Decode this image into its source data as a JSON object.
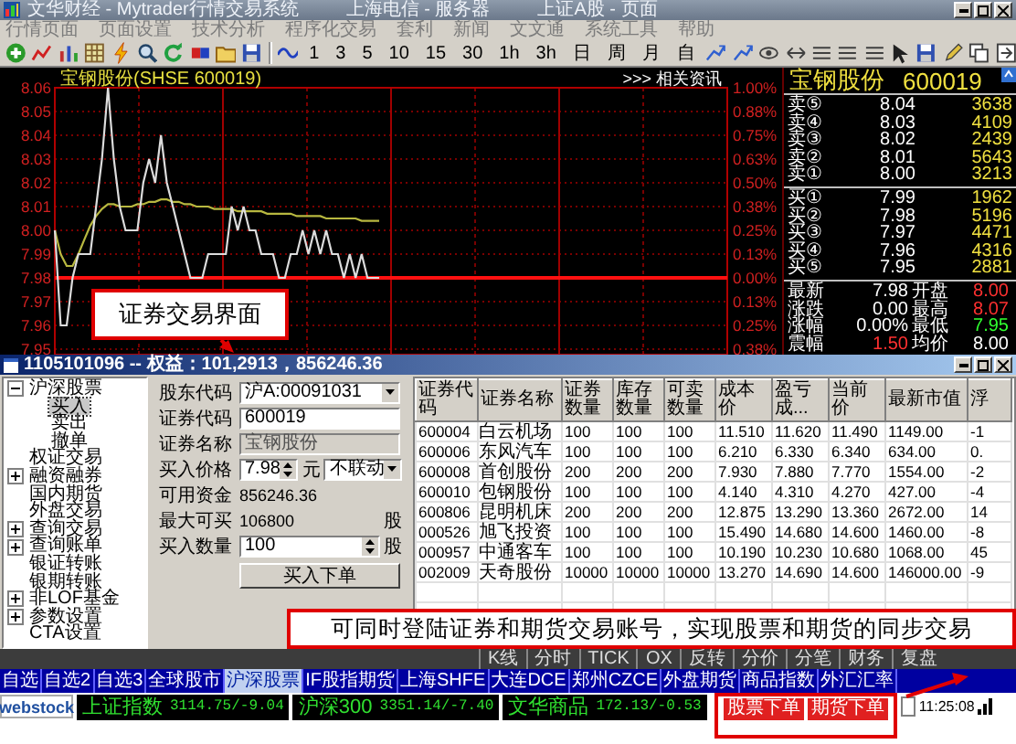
{
  "window": {
    "title": "文华财经 - Mytrader行情交易系统",
    "server": "上海电信 - 服务器",
    "page": "上证A股 - 页面"
  },
  "menu": [
    "行情页面",
    "页面设置",
    "技术分析",
    "程序化交易",
    "套利",
    "新闻",
    "文文通",
    "系统工具",
    "帮助"
  ],
  "toolbar": {
    "periods": [
      "1",
      "3",
      "5",
      "10",
      "15",
      "30",
      "1h",
      "3h",
      "日",
      "周",
      "月",
      "自"
    ]
  },
  "chart": {
    "title": "宝钢股份(SHSE 600019)",
    "link": ">>> 相关资讯",
    "chart_data": {
      "type": "line",
      "grid": true,
      "ylim": [
        7.95,
        8.06
      ],
      "yticks": [
        8.06,
        8.05,
        8.04,
        8.03,
        8.02,
        8.01,
        {
          "value": 8.0,
          "label": "8.00"
        },
        7.99,
        7.98,
        7.97,
        7.96,
        7.95
      ],
      "series": [
        {
          "color": "#dcdcdc",
          "values": [
            8.0,
            7.96,
            7.96,
            7.98,
            7.99,
            7.99,
            7.99,
            8.01,
            8.03,
            8.06,
            8.03,
            8.01,
            8.0,
            8.0,
            8.0,
            8.02,
            8.03,
            8.02,
            8.04,
            8.02,
            8.01,
            8.0,
            7.99,
            7.98,
            7.98,
            7.98,
            7.99,
            7.99,
            7.99,
            7.99,
            8.01,
            8.0,
            8.01,
            8.0,
            8.0,
            7.99,
            7.99,
            7.99,
            7.98,
            7.98,
            7.99,
            7.99,
            8.0,
            7.99,
            8.0,
            7.99,
            8.0,
            7.99,
            7.99,
            7.98,
            7.99,
            7.98,
            7.99,
            7.98,
            7.98,
            7.98,
            null,
            null,
            null,
            null,
            null,
            null,
            null,
            null,
            null,
            null,
            null,
            null,
            null,
            null,
            null,
            null,
            null,
            null,
            null,
            null,
            null,
            null,
            null,
            null,
            null,
            null,
            null,
            null,
            null,
            null,
            null,
            null,
            null,
            null,
            null,
            null,
            null,
            null,
            null,
            null,
            null,
            null,
            null,
            null,
            null,
            null,
            null,
            null,
            null,
            null,
            null,
            null,
            null,
            null,
            null,
            null,
            null,
            null,
            null
          ]
        },
        {
          "color": "#b8b840",
          "values": [
            8.0,
            7.99,
            7.985,
            7.985,
            7.99,
            7.996,
            8.002,
            8.006,
            8.009,
            8.011,
            8.011,
            8.01,
            8.01,
            8.01,
            8.011,
            8.011,
            8.012,
            8.012,
            8.013,
            8.013,
            8.012,
            8.012,
            8.011,
            8.011,
            8.01,
            8.01,
            8.01,
            8.009,
            8.009,
            8.009,
            8.009,
            8.008,
            8.008,
            8.008,
            8.008,
            8.008,
            8.007,
            8.007,
            8.007,
            8.007,
            8.007,
            8.006,
            8.006,
            8.006,
            8.006,
            8.006,
            8.005,
            8.005,
            8.005,
            8.005,
            8.005,
            8.005,
            8.004,
            8.004,
            8.004,
            8.004,
            null,
            null,
            null,
            null,
            null,
            null,
            null,
            null,
            null,
            null,
            null,
            null,
            null,
            null,
            null,
            null,
            null,
            null,
            null,
            null,
            null,
            null,
            null,
            null,
            null,
            null,
            null,
            null,
            null,
            null,
            null,
            null,
            null,
            null,
            null,
            null,
            null,
            null,
            null,
            null,
            null,
            null,
            null,
            null,
            null,
            null,
            null,
            null,
            null,
            null,
            null,
            null,
            null,
            null,
            null,
            null,
            null,
            null,
            null
          ]
        },
        {
          "color": "#ff1010",
          "values": [
            7.98,
            7.98,
            7.98,
            7.98,
            7.98,
            7.98,
            7.98,
            7.98,
            7.98,
            7.98,
            7.98,
            7.98,
            7.98,
            7.98,
            7.98,
            7.98,
            7.98,
            7.98,
            7.98,
            7.98,
            7.98,
            7.98,
            7.98,
            7.98,
            7.98,
            7.98,
            7.98,
            7.98,
            7.98,
            7.98,
            7.98,
            7.98,
            7.98,
            7.98,
            7.98,
            7.98,
            7.98,
            7.98,
            7.98,
            7.98,
            7.98,
            7.98,
            7.98,
            7.98,
            7.98,
            7.98,
            7.98,
            7.98,
            7.98,
            7.98,
            7.98,
            7.98,
            7.98,
            7.98,
            7.98,
            7.98,
            7.98,
            7.98,
            7.98,
            7.98,
            7.98,
            7.98,
            7.98,
            7.98,
            7.98,
            7.98,
            7.98,
            7.98,
            7.98,
            7.98,
            7.98,
            7.98,
            7.98,
            7.98,
            7.98,
            7.98,
            7.98,
            7.98,
            7.98,
            7.98,
            7.98,
            7.98,
            7.98,
            7.98,
            7.98,
            7.98,
            7.98,
            7.98,
            7.98,
            7.98,
            7.98,
            7.98,
            7.98,
            7.98,
            7.98,
            7.98,
            7.98,
            7.98,
            7.98,
            7.98,
            7.98,
            7.98,
            7.98,
            7.98,
            7.98,
            7.98,
            7.98,
            7.98,
            7.98,
            7.98,
            7.98,
            7.98,
            7.98,
            7.98,
            7.98
          ]
        }
      ]
    },
    "percent_ticks": [
      "1.00%",
      "0.88%",
      "0.75%",
      "0.63%",
      "0.50%",
      "0.38%",
      "0.25%",
      "0.13%",
      "0.00%",
      "0.13%",
      "0.25%",
      "0.38%"
    ]
  },
  "quote": {
    "name": "宝钢股份",
    "code": "600019",
    "asks": [
      {
        "label": "卖⑤",
        "price": "8.04",
        "volume": "3638"
      },
      {
        "label": "卖④",
        "price": "8.03",
        "volume": "4109"
      },
      {
        "label": "卖③",
        "price": "8.02",
        "volume": "2439"
      },
      {
        "label": "卖②",
        "price": "8.01",
        "volume": "5643"
      },
      {
        "label": "卖①",
        "price": "8.00",
        "volume": "3213"
      }
    ],
    "bids": [
      {
        "label": "买①",
        "price": "7.99",
        "volume": "1962"
      },
      {
        "label": "买②",
        "price": "7.98",
        "volume": "5196"
      },
      {
        "label": "买③",
        "price": "7.97",
        "volume": "4471"
      },
      {
        "label": "买④",
        "price": "7.96",
        "volume": "4316"
      },
      {
        "label": "买⑤",
        "price": "7.95",
        "volume": "2881"
      }
    ],
    "stats": [
      {
        "label": "最新",
        "value": "7.98",
        "color": "#ffffff"
      },
      {
        "label": "开盘",
        "value": "8.00",
        "color": "#ff3030"
      },
      {
        "label": "涨跌",
        "value": "0.00",
        "color": "#ffffff"
      },
      {
        "label": "最高",
        "value": "8.07",
        "color": "#ff3030"
      },
      {
        "label": "涨幅",
        "value": "0.00%",
        "color": "#ffffff"
      },
      {
        "label": "最低",
        "value": "7.95",
        "color": "#30ff30"
      },
      {
        "label": "震幅",
        "value": "1.50",
        "color": "#ff3030"
      },
      {
        "label": "均价",
        "value": "8.00",
        "color": "#ffffff"
      }
    ]
  },
  "trade": {
    "title": "1105101096 -- 权益：101,2913，856246.36",
    "tree": [
      {
        "label": "沪深股票",
        "expanded": true,
        "selected": false,
        "children": [
          {
            "label": "买入",
            "selected": true
          },
          {
            "label": "卖出",
            "selected": false
          },
          {
            "label": "撤单",
            "selected": false
          }
        ]
      },
      {
        "label": "权证交易",
        "selected": false
      },
      {
        "label": "融资融券",
        "expanded": false,
        "selected": false
      },
      {
        "label": "国内期货",
        "selected": false
      },
      {
        "label": "外盘交易",
        "selected": false
      },
      {
        "label": "查询交易",
        "expanded": false,
        "selected": false
      },
      {
        "label": "查询账单",
        "expanded": false,
        "selected": false
      },
      {
        "label": "银证转账",
        "selected": false
      },
      {
        "label": "银期转账",
        "selected": false
      },
      {
        "label": "非LOF基金",
        "expanded": false,
        "selected": false
      },
      {
        "label": "参数设置",
        "expanded": false,
        "selected": false
      },
      {
        "label": "CTA设置",
        "selected": false
      }
    ],
    "form": {
      "rows": [
        {
          "kind": "select",
          "label": "股东代码",
          "value": "沪A:00091031"
        },
        {
          "kind": "input",
          "label": "证券代码",
          "value": "600019",
          "disabled": false
        },
        {
          "kind": "input",
          "label": "证券名称",
          "value": "宝钢股份",
          "disabled": true
        },
        {
          "kind": "price",
          "label": "买入价格",
          "value": "7.98",
          "unit": "元",
          "mode": "不联动"
        },
        {
          "kind": "info",
          "label": "可用资金",
          "value": "856246.36"
        },
        {
          "kind": "info",
          "label": "最大可买",
          "value": "106800",
          "unit": "股"
        },
        {
          "kind": "spin",
          "label": "买入数量",
          "value": "100",
          "unit": "股"
        }
      ],
      "submit": "买入下单"
    },
    "table": {
      "columns": [
        "证券代码",
        "证券名称",
        "证券数量",
        "库存数量",
        "可卖数量",
        "成本价",
        "盈亏成...",
        "当前价",
        "最新市值",
        "浮"
      ],
      "rows": [
        [
          "600004",
          "白云机场",
          "100",
          "100",
          "100",
          "11.510",
          "11.620",
          "11.490",
          "1149.00",
          "-1"
        ],
        [
          "600006",
          "东风汽车",
          "100",
          "100",
          "100",
          "6.210",
          "6.330",
          "6.340",
          "634.00",
          "0."
        ],
        [
          "600008",
          "首创股份",
          "200",
          "200",
          "200",
          "7.930",
          "7.880",
          "7.770",
          "1554.00",
          "-2"
        ],
        [
          "600010",
          "包钢股份",
          "100",
          "100",
          "100",
          "4.140",
          "4.310",
          "4.270",
          "427.00",
          "-4"
        ],
        [
          "600806",
          "昆明机床",
          "200",
          "200",
          "200",
          "12.875",
          "13.290",
          "13.360",
          "2672.00",
          "14"
        ],
        [
          "000526",
          "旭飞投资",
          "100",
          "100",
          "100",
          "15.490",
          "14.680",
          "14.600",
          "1460.00",
          "-8"
        ],
        [
          "000957",
          "中通客车",
          "100",
          "100",
          "100",
          "10.190",
          "10.230",
          "10.680",
          "1068.00",
          "45"
        ],
        [
          "002009",
          "天奇股份",
          "10000",
          "10000",
          "10000",
          "13.270",
          "14.690",
          "14.600",
          "146000.00",
          "-9"
        ]
      ]
    }
  },
  "bottom": {
    "tools": [
      "K线",
      "分时",
      "TICK",
      "OX",
      "反转",
      "分价",
      "分笔",
      "财务",
      "复盘"
    ],
    "sheets": [
      {
        "label": "自选",
        "selected": false
      },
      {
        "label": "自选2",
        "selected": false
      },
      {
        "label": "自选3",
        "selected": false
      },
      {
        "label": "全球股市",
        "selected": false
      },
      {
        "label": "沪深股票",
        "selected": true
      },
      {
        "label": "IF股指期货",
        "selected": false
      },
      {
        "label": "上海SHFE",
        "selected": false
      },
      {
        "label": "大连DCE",
        "selected": false
      },
      {
        "label": "郑州CZCE",
        "selected": false
      },
      {
        "label": "外盘期货",
        "selected": false
      },
      {
        "label": "商品指数",
        "selected": false
      },
      {
        "label": "外汇汇率",
        "selected": false
      }
    ],
    "logo": "webstock",
    "indices": [
      {
        "name": "上证指数",
        "value": "3114.75/-9.04"
      },
      {
        "name": "沪深300",
        "value": "3351.14/-7.40"
      },
      {
        "name": "文华商品",
        "value": "172.13/-0.53"
      }
    ],
    "order_buttons": [
      "股票下单",
      "期货下单"
    ],
    "time": "11:25:08"
  },
  "callouts": [
    {
      "text": "证券交易界面"
    },
    {
      "text": "可同时登陆证券和期货交易账号，实现股票和期货的同步交易"
    }
  ]
}
